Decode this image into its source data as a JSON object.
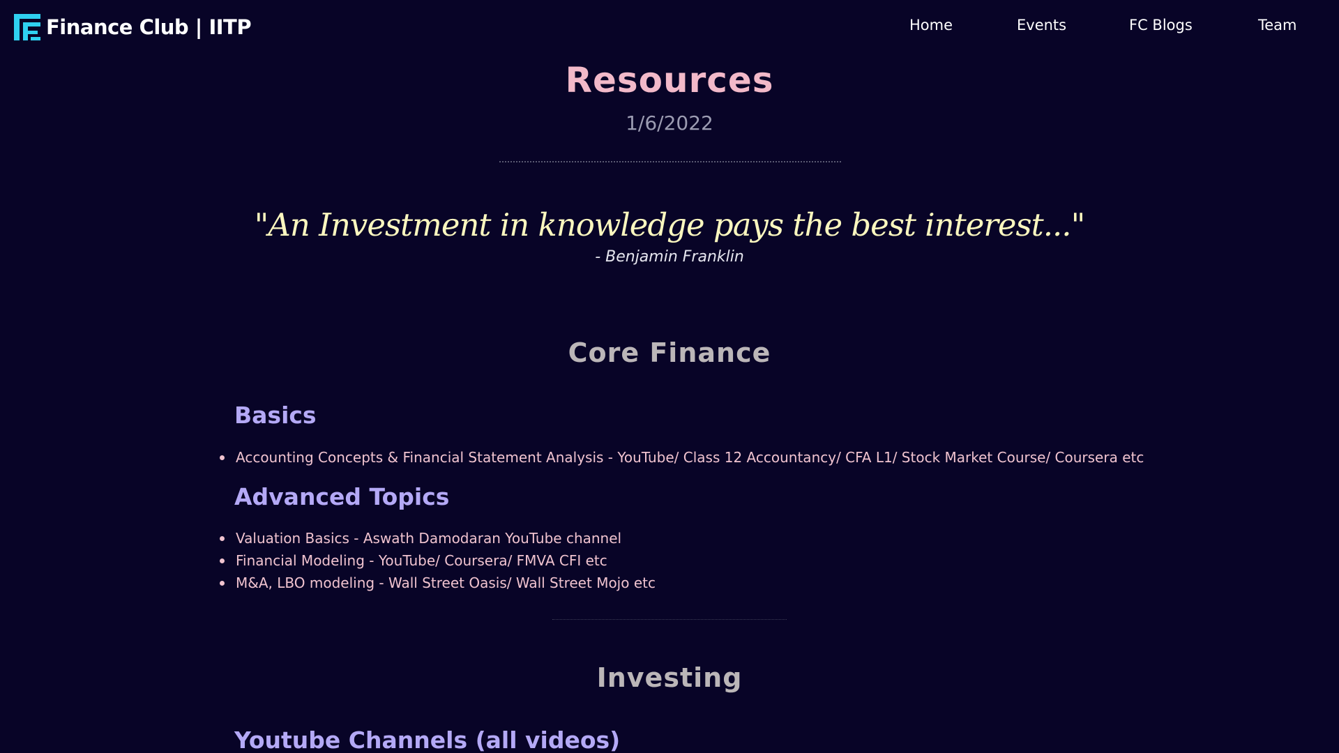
{
  "brand": {
    "name": "Finance Club | IITP",
    "logo_icon": "fc-logo-icon",
    "logo_color": "#2fd0f0"
  },
  "nav": {
    "items": [
      {
        "label": "Home"
      },
      {
        "label": "Events"
      },
      {
        "label": "FC Blogs"
      },
      {
        "label": "Team"
      }
    ]
  },
  "page": {
    "title": "Resources",
    "date": "1/6/2022",
    "quote": "\"An Investment in knowledge pays the best interest...\"",
    "quote_author": "- Benjamin Franklin"
  },
  "sections": [
    {
      "title": "Core Finance",
      "groups": [
        {
          "title": "Basics",
          "items": [
            "Accounting Concepts & Financial Statement Analysis - YouTube/ Class 12 Accountancy/ CFA L1/ Stock Market Course/ Coursera etc"
          ]
        },
        {
          "title": "Advanced Topics",
          "items": [
            "Valuation Basics - Aswath Damodaran YouTube channel",
            "Financial Modeling - YouTube/ Coursera/ FMVA CFI etc",
            "M&A, LBO modeling - Wall Street Oasis/ Wall Street Mojo etc"
          ]
        }
      ]
    },
    {
      "title": "Investing",
      "groups": [
        {
          "title": "Youtube Channels (all videos)",
          "items": []
        }
      ]
    }
  ],
  "colors": {
    "background": "#080427",
    "title": "#f2b9c9",
    "quote": "#fbf7bf",
    "section_title": "#bbb6b8",
    "sub_title": "#b4a9f6",
    "list_text": "#f0c3cf"
  }
}
